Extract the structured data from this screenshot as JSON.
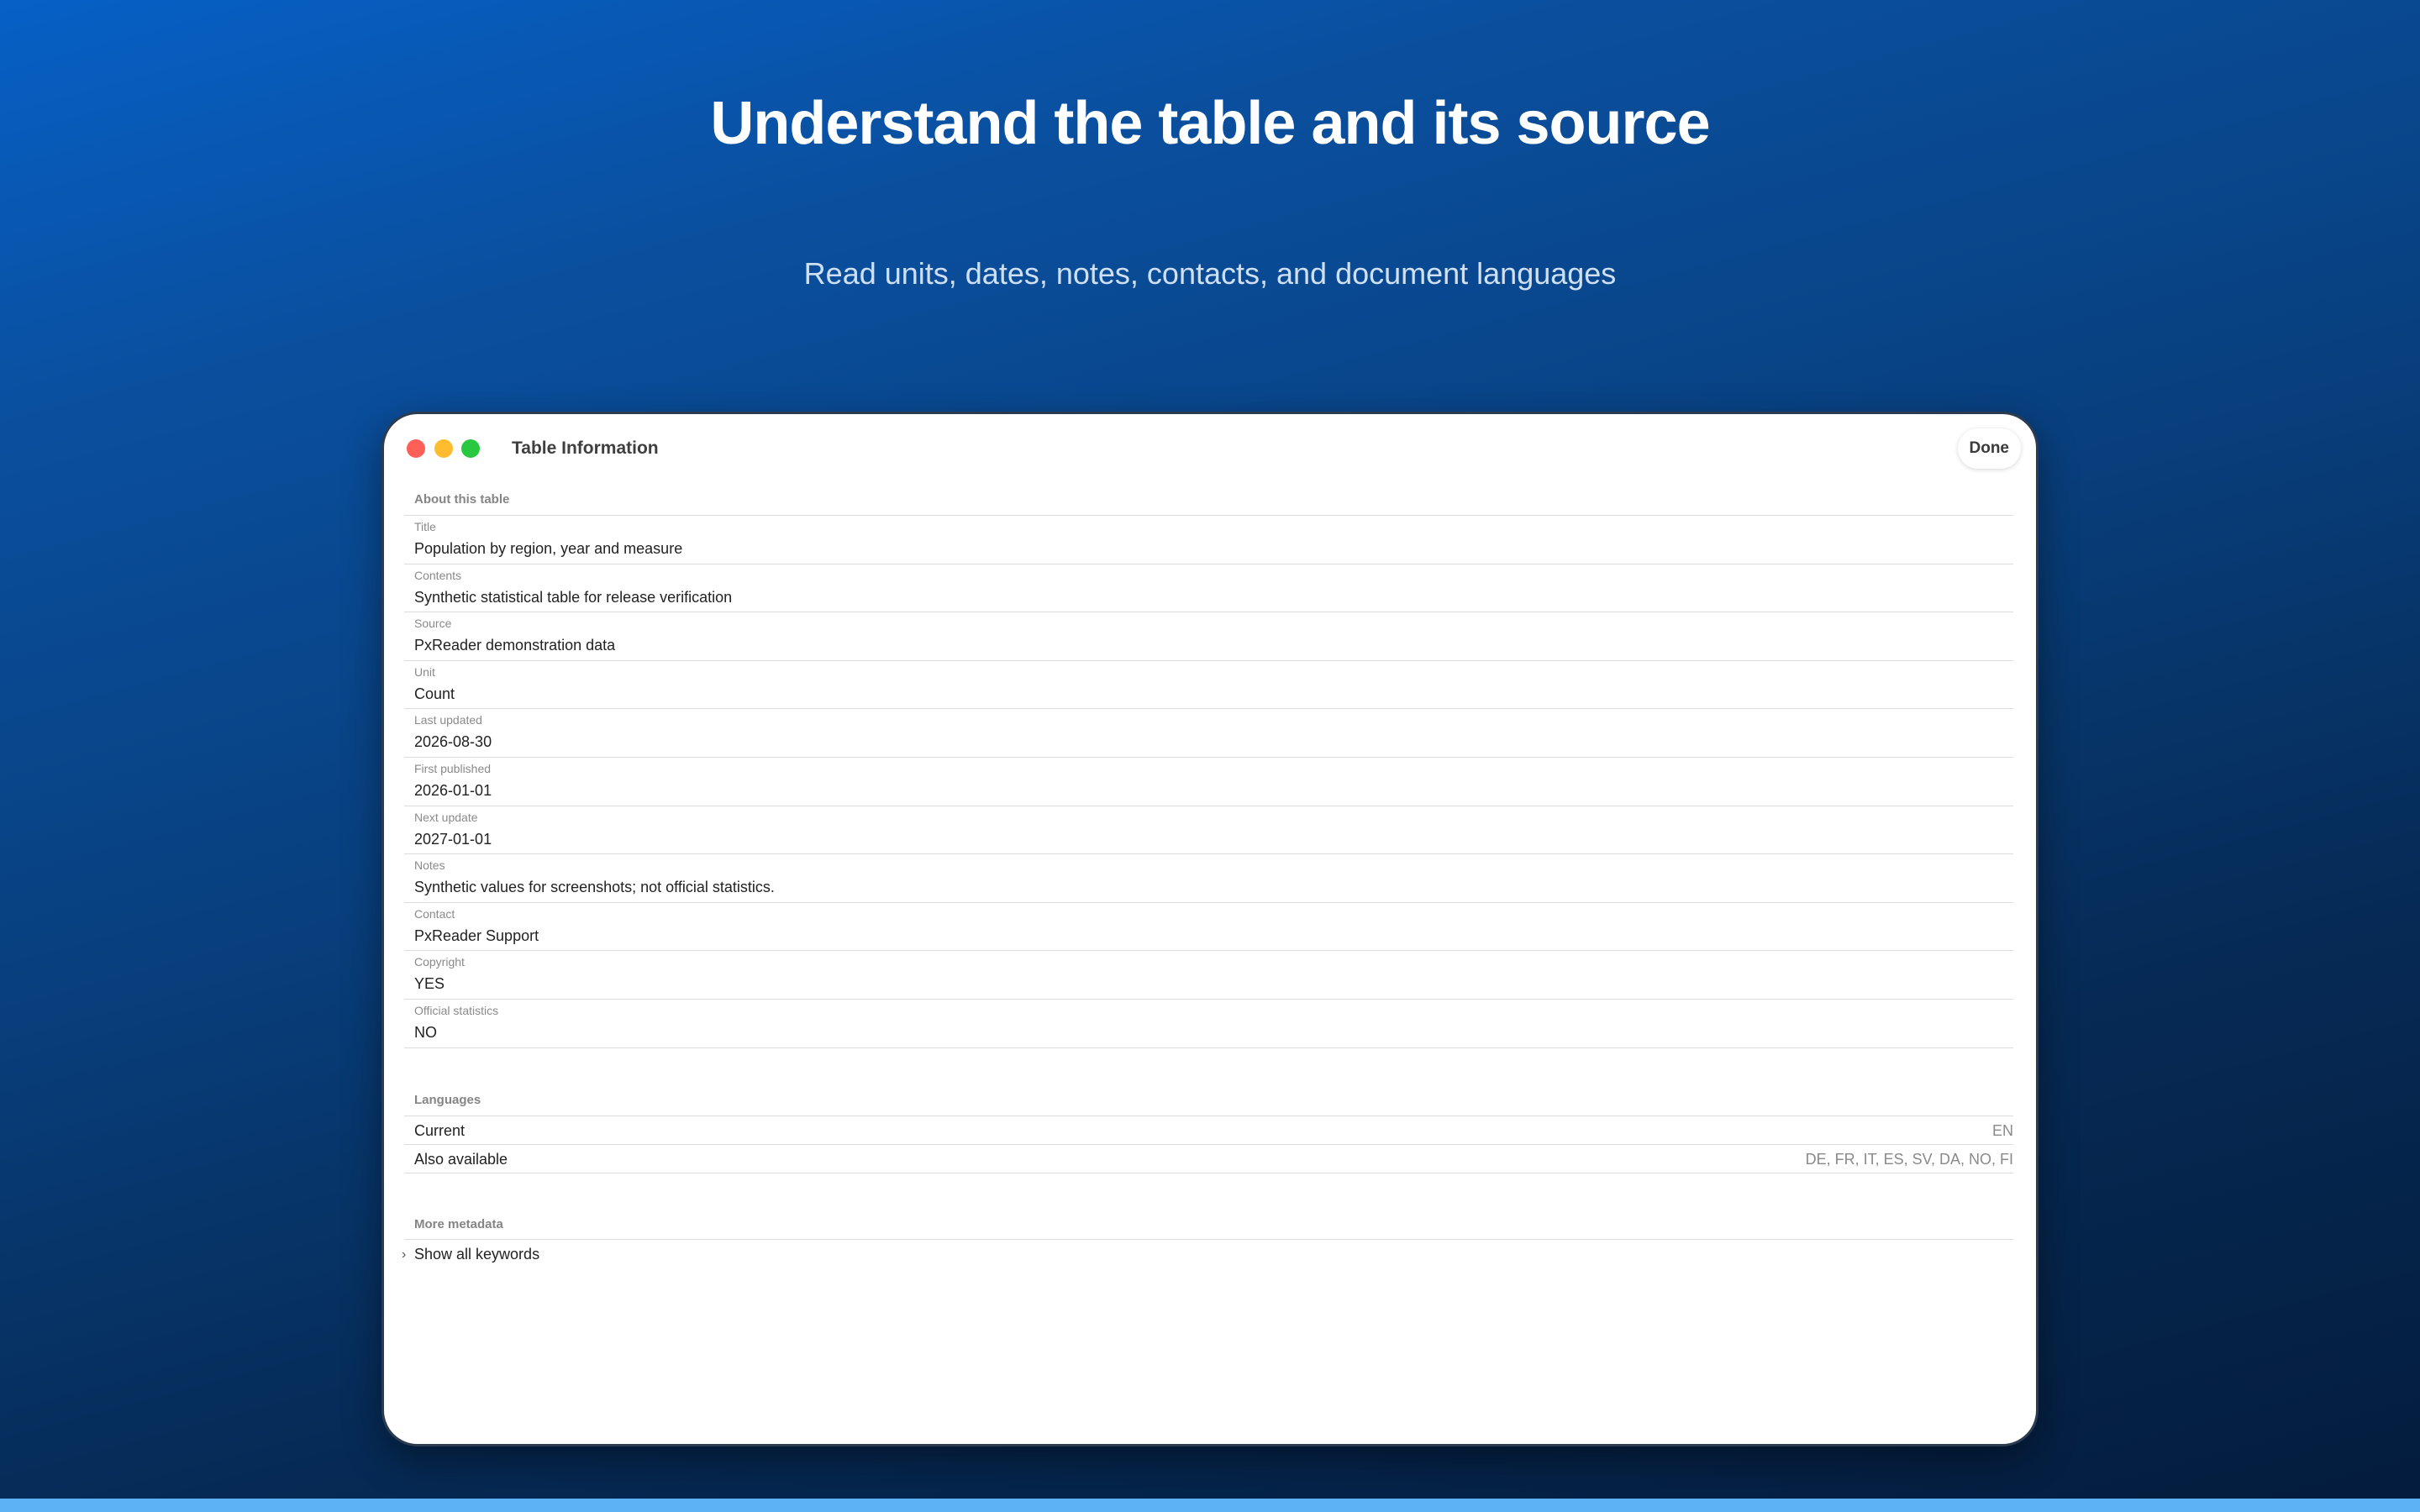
{
  "hero": {
    "headline": "Understand the table and its source",
    "subheadline": "Read units, dates, notes, contacts, and document languages"
  },
  "window": {
    "title": "Table Information",
    "done_label": "Done",
    "traffic_lights": [
      "close",
      "minimize",
      "zoom"
    ]
  },
  "about": {
    "header": "About this table",
    "fields": [
      {
        "label": "Title",
        "value": "Population by region, year and measure"
      },
      {
        "label": "Contents",
        "value": "Synthetic statistical table for release verification"
      },
      {
        "label": "Source",
        "value": "PxReader demonstration data"
      },
      {
        "label": "Unit",
        "value": "Count"
      },
      {
        "label": "Last updated",
        "value": "2026-08-30"
      },
      {
        "label": "First published",
        "value": "2026-01-01"
      },
      {
        "label": "Next update",
        "value": "2027-01-01"
      },
      {
        "label": "Notes",
        "value": "Synthetic values for screenshots; not official statistics."
      },
      {
        "label": "Contact",
        "value": "PxReader Support"
      },
      {
        "label": "Copyright",
        "value": "YES"
      },
      {
        "label": "Official statistics",
        "value": "NO"
      }
    ]
  },
  "languages": {
    "header": "Languages",
    "rows": [
      {
        "label": "Current",
        "value": "EN"
      },
      {
        "label": "Also available",
        "value": "DE, FR, IT, ES, SV, DA, NO, FI"
      }
    ]
  },
  "more_metadata": {
    "header": "More metadata",
    "disclosure_label": "Show all keywords",
    "chevron_icon": "chevron-right-icon"
  },
  "colors": {
    "background_top": "#0660c6",
    "background_bottom": "#041c3d",
    "bottom_strip": "#5db2f5",
    "traffic_close": "#fe5f57",
    "traffic_minimize": "#febc2e",
    "traffic_zoom": "#28c840"
  }
}
